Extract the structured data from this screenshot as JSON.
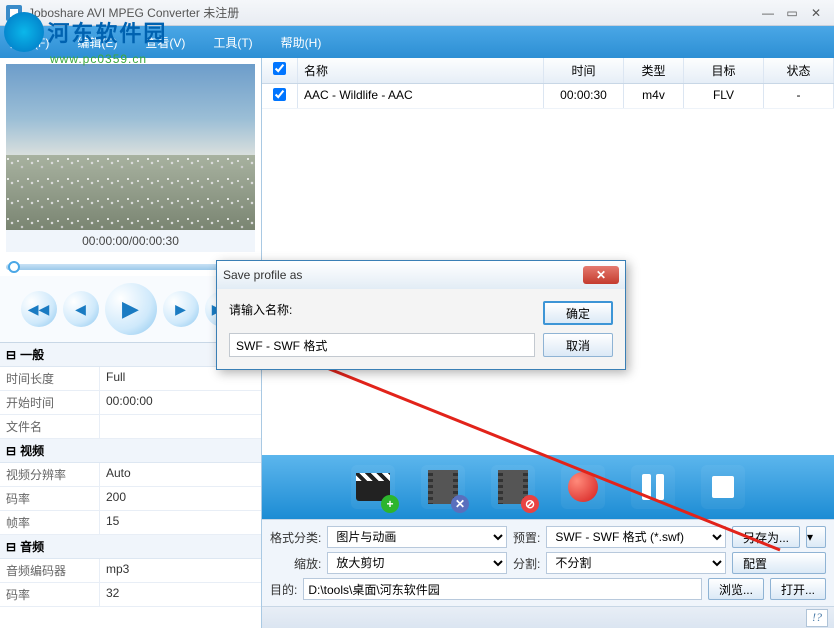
{
  "title": "Joboshare AVI MPEG Converter 未注册",
  "watermark": {
    "name": "河东软件园",
    "url": "www.pc0359.cn"
  },
  "menu": {
    "file": "文件(F)",
    "edit": "编辑(E)",
    "view": "查看(V)",
    "tool": "工具(T)",
    "help": "帮助(H)"
  },
  "preview": {
    "time": "00:00:00/00:00:30"
  },
  "props": {
    "general": {
      "head": "一般",
      "items": [
        {
          "k": "时间长度",
          "v": "Full"
        },
        {
          "k": "开始时间",
          "v": "00:00:00"
        },
        {
          "k": "文件名",
          "v": ""
        }
      ]
    },
    "video": {
      "head": "视频",
      "items": [
        {
          "k": "视频分辨率",
          "v": "Auto"
        },
        {
          "k": "码率",
          "v": "200"
        },
        {
          "k": "帧率",
          "v": "15"
        }
      ]
    },
    "audio": {
      "head": "音频",
      "items": [
        {
          "k": "音频编码器",
          "v": "mp3"
        },
        {
          "k": "码率",
          "v": "32"
        }
      ]
    }
  },
  "table": {
    "cols": {
      "name": "名称",
      "time": "时间",
      "type": "类型",
      "target": "目标",
      "status": "状态"
    },
    "rows": [
      {
        "name": "AAC - Wildlife - AAC",
        "time": "00:00:30",
        "type": "m4v",
        "target": "FLV",
        "status": "-"
      }
    ]
  },
  "settings": {
    "formatCat": {
      "label": "格式分类:",
      "value": "图片与动画"
    },
    "preset": {
      "label": "预置:",
      "value": "SWF - SWF 格式 (*.swf)"
    },
    "saveas": "另存为...",
    "zoom": {
      "label": "缩放:",
      "value": "放大剪切"
    },
    "split": {
      "label": "分割:",
      "value": "不分割"
    },
    "config": "配置",
    "dest": {
      "label": "目的:",
      "value": "D:\\tools\\桌面\\河东软件园"
    },
    "browse": "浏览...",
    "open": "打开..."
  },
  "dialog": {
    "title": "Save profile as",
    "label": "请输入名称:",
    "value": "SWF - SWF 格式",
    "ok": "确定",
    "cancel": "取消"
  }
}
